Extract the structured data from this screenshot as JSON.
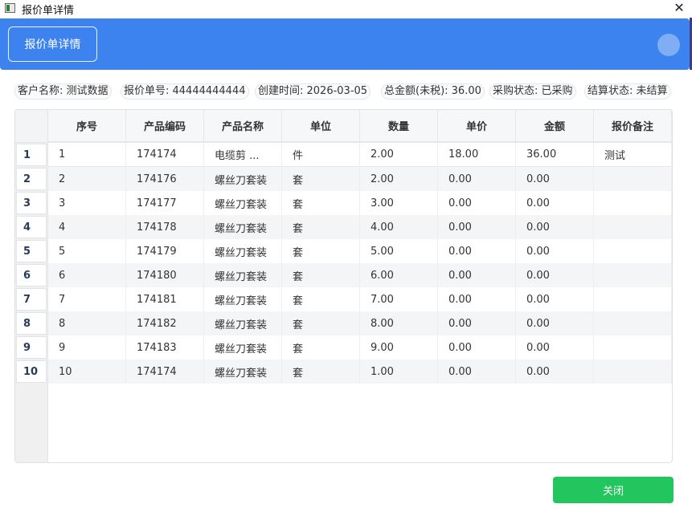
{
  "window": {
    "title": "报价单详情",
    "close_glyph": "✕"
  },
  "banner": {
    "button_label": "报价单详情"
  },
  "info": [
    {
      "label": "客户名称",
      "value": "测试数据",
      "text": "客户名称: 测试数据"
    },
    {
      "label": "报价单号",
      "value": "44444444444",
      "text": "报价单号: 44444444444"
    },
    {
      "label": "创建时间",
      "value": "2026-03-05",
      "text": "创建时间: 2026-03-05"
    },
    {
      "label": "总金额(未税)",
      "value": "36.00",
      "text": "总金额(未税): 36.00"
    },
    {
      "label": "采购状态",
      "value": "已采购",
      "text": "采购状态: 已采购"
    },
    {
      "label": "结算状态",
      "value": "未结算",
      "text": "结算状态: 未结算"
    }
  ],
  "table": {
    "columns": [
      "序号",
      "产品编码",
      "产品名称",
      "单位",
      "数量",
      "单价",
      "金额",
      "报价备注"
    ],
    "row_numbers": [
      "1",
      "2",
      "3",
      "4",
      "5",
      "6",
      "7",
      "8",
      "9",
      "10"
    ],
    "rows": [
      [
        "1",
        "174174",
        "电缆剪 ...",
        "件",
        "2.00",
        "18.00",
        "36.00",
        "测试"
      ],
      [
        "2",
        "174176",
        "螺丝刀套装",
        "套",
        "2.00",
        "0.00",
        "0.00",
        ""
      ],
      [
        "3",
        "174177",
        "螺丝刀套装",
        "套",
        "3.00",
        "0.00",
        "0.00",
        ""
      ],
      [
        "4",
        "174178",
        "螺丝刀套装",
        "套",
        "4.00",
        "0.00",
        "0.00",
        ""
      ],
      [
        "5",
        "174179",
        "螺丝刀套装",
        "套",
        "5.00",
        "0.00",
        "0.00",
        ""
      ],
      [
        "6",
        "174180",
        "螺丝刀套装",
        "套",
        "6.00",
        "0.00",
        "0.00",
        ""
      ],
      [
        "7",
        "174181",
        "螺丝刀套装",
        "套",
        "7.00",
        "0.00",
        "0.00",
        ""
      ],
      [
        "8",
        "174182",
        "螺丝刀套装",
        "套",
        "8.00",
        "0.00",
        "0.00",
        ""
      ],
      [
        "9",
        "174183",
        "螺丝刀套装",
        "套",
        "9.00",
        "0.00",
        "0.00",
        ""
      ],
      [
        "10",
        "174174",
        "螺丝刀套装",
        "套",
        "1.00",
        "0.00",
        "0.00",
        ""
      ]
    ]
  },
  "footer": {
    "close_label": "关闭"
  },
  "colors": {
    "banner": "#3c83f0",
    "close_button": "#22c55e"
  },
  "icons": {
    "app": "window-app-icon",
    "close": "close-icon",
    "avatar": "avatar-circle"
  }
}
